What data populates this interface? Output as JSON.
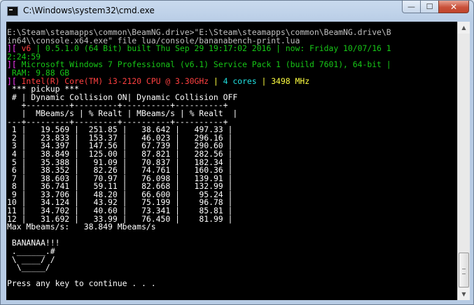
{
  "window": {
    "title": "C:\\Windows\\system32\\cmd.exe",
    "minimize_glyph": "—",
    "maximize_glyph": "☐",
    "close_glyph": "✕"
  },
  "console": {
    "line_01": "E:\\Steam\\steamapps\\common\\BeamNG.drive>\"E:\\Steam\\steamapps\\common\\BeamNG.drive\\Bin64\\\\console.x64.exe\" file lua/console/bananabench-print.lua",
    "line_01a": "E:\\Steam\\steamapps\\common\\BeamNG.drive>\"E:\\Steam\\steamapps\\common\\BeamNG.drive\\B",
    "line_01b": "in64\\\\console.x64.exe\" file lua/console/bananabench-print.lua",
    "line_02_bar": "][",
    "line_02_ver": " v6 ",
    "line_02_build": "| 0.5.1.0 (64 Bit) built Thu Sep 29 19:17:02 2016 |",
    "line_02_now": " now: Friday 10/07/16 1",
    "line_03_time": "2:24:59",
    "line_04_bar": "][",
    "line_04_os": " Microsoft Windows 7 Professional (v6.1) Service Pack 1 (build 7601), 64-bit |",
    "line_05_ram": " RAM: 9.88 GB",
    "line_06_bar": "][",
    "line_06_cpu": " Intel(R) Core(TM) i3-2120 CPU @ 3.30GHz",
    "line_06_sep1": " | ",
    "line_06_cores": "4 cores",
    "line_06_sep2": " | ",
    "line_06_mhz": "3498 MHz",
    "line_07": " *** pickup ***",
    "line_08": " # | Dynamic Collision ON| Dynamic Collision OFF",
    "line_09": "   +---------+---------+----------+----------+",
    "line_10": "   |  MBeams/s | % Realt | MBeams/s | % Realt  |",
    "line_11": "---+---------+---------+----------+----------+"
  },
  "table": {
    "rows": [
      {
        "n": "1",
        "on_mb": "19.569",
        "on_rt": "251.85",
        "off_mb": "38.642",
        "off_rt": "497.33"
      },
      {
        "n": "2",
        "on_mb": "23.833",
        "on_rt": "153.37",
        "off_mb": "46.023",
        "off_rt": "296.16"
      },
      {
        "n": "3",
        "on_mb": "34.397",
        "on_rt": "147.56",
        "off_mb": "67.739",
        "off_rt": "290.60"
      },
      {
        "n": "4",
        "on_mb": "38.849",
        "on_rt": "125.00",
        "off_mb": "87.821",
        "off_rt": "282.56"
      },
      {
        "n": "5",
        "on_mb": "35.388",
        "on_rt": "91.09",
        "off_mb": "70.837",
        "off_rt": "182.34"
      },
      {
        "n": "6",
        "on_mb": "38.352",
        "on_rt": "82.26",
        "off_mb": "74.761",
        "off_rt": "160.36"
      },
      {
        "n": "7",
        "on_mb": "38.603",
        "on_rt": "70.97",
        "off_mb": "76.098",
        "off_rt": "139.91"
      },
      {
        "n": "8",
        "on_mb": "36.741",
        "on_rt": "59.11",
        "off_mb": "82.668",
        "off_rt": "132.99"
      },
      {
        "n": "9",
        "on_mb": "33.706",
        "on_rt": "48.20",
        "off_mb": "66.600",
        "off_rt": "95.24"
      },
      {
        "n": "10",
        "on_mb": "34.124",
        "on_rt": "43.92",
        "off_mb": "75.199",
        "off_rt": "96.78"
      },
      {
        "n": "11",
        "on_mb": "34.702",
        "on_rt": "40.60",
        "off_mb": "73.341",
        "off_rt": "85.81"
      },
      {
        "n": "12",
        "on_mb": "31.692",
        "on_rt": "33.99",
        "off_mb": "76.450",
        "off_rt": "81.99"
      }
    ]
  },
  "footer": {
    "max_line": "Max Mbeams/s:   38.849 Mbeams/s",
    "banana_1": " BANANAA!!!",
    "banana_2": " .______.#",
    "banana_3": " \\ ____/ /",
    "banana_4": "  \\_____/",
    "prompt": "Press any key to continue . . ."
  },
  "colors": {
    "console_bg": "#000000",
    "console_fg": "#c0c0c0",
    "magenta": "#ff3cff",
    "green": "#17c817",
    "red": "#ff4040",
    "cyan": "#20e0e0",
    "yellow": "#ffff40"
  }
}
